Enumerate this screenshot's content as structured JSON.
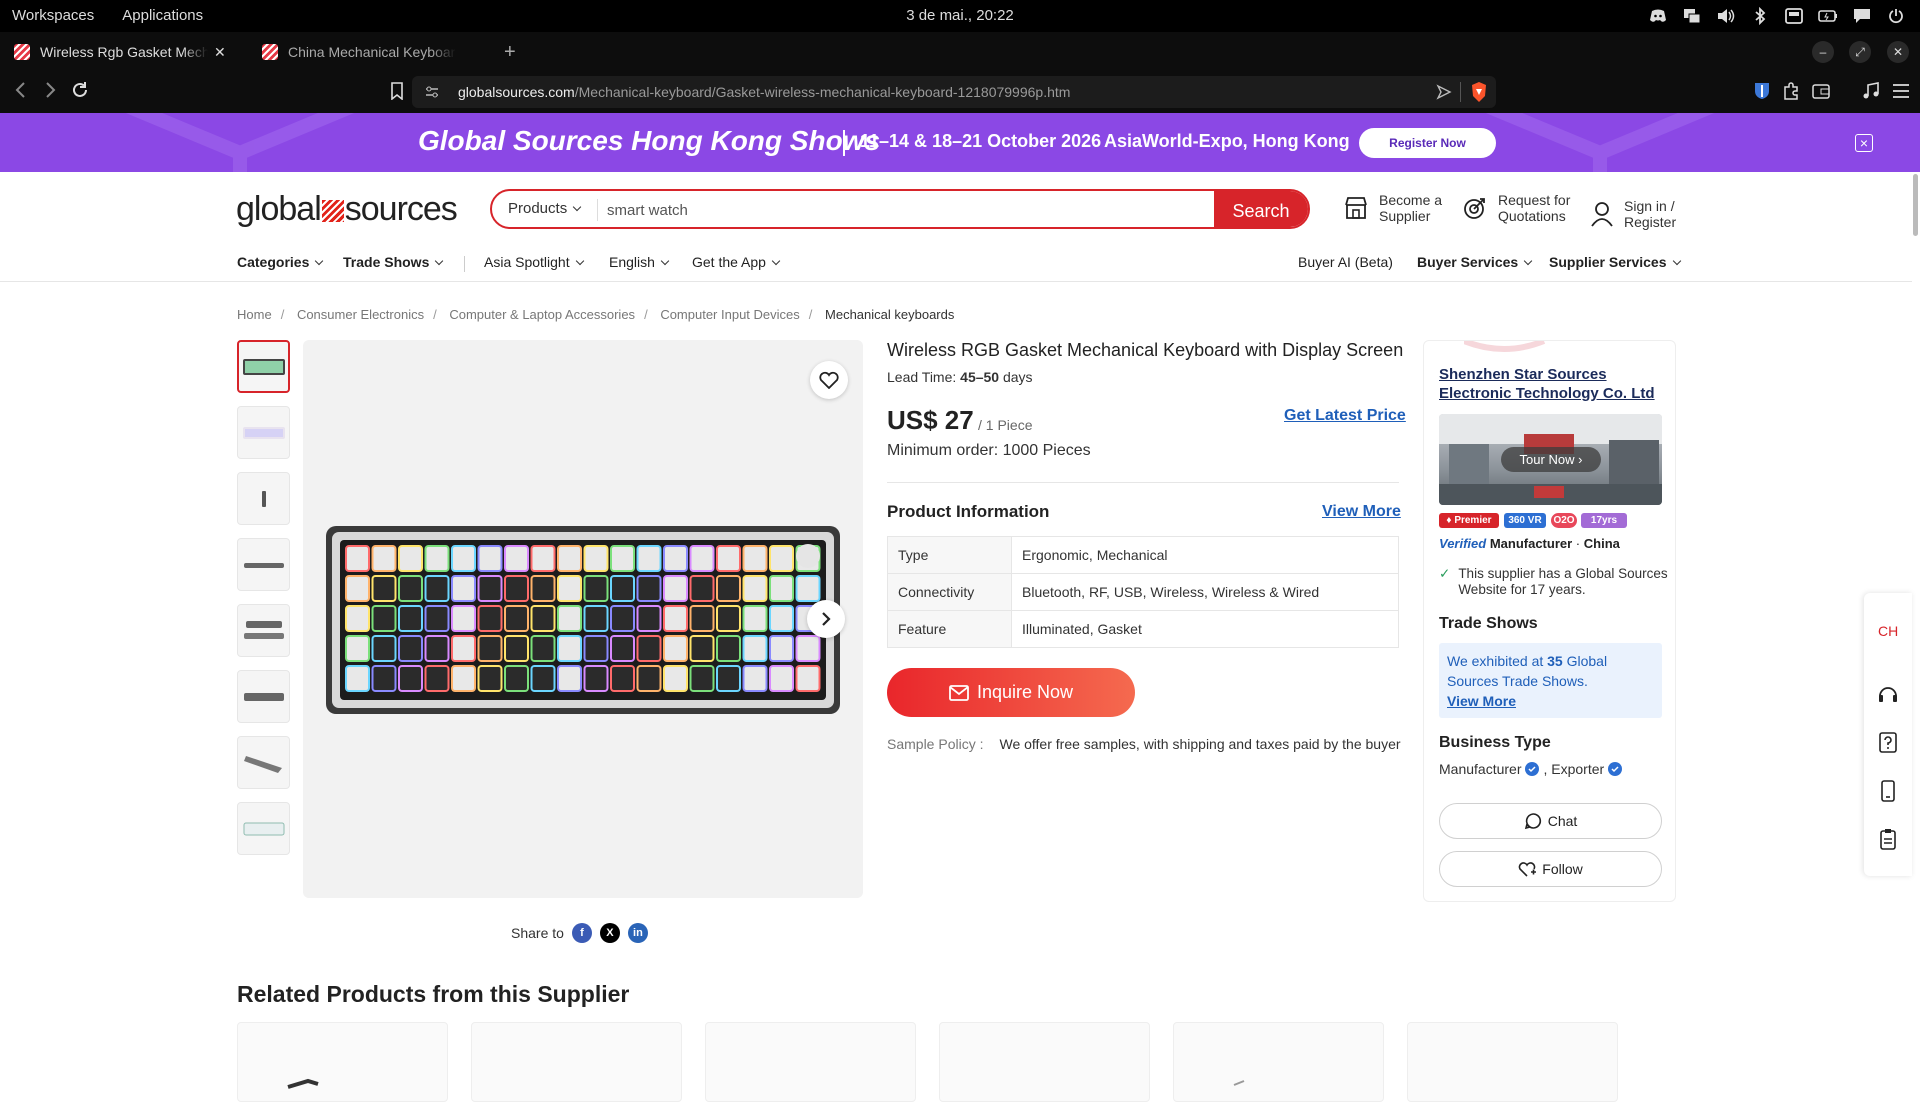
{
  "os": {
    "left_items": [
      "Workspaces",
      "Applications"
    ],
    "clock": "3 de mai., 20:22",
    "tray_icons": [
      "discord-icon",
      "network-icon",
      "volume-icon",
      "bluetooth-icon",
      "screen-icon",
      "battery-icon",
      "chat-icon",
      "power-icon"
    ]
  },
  "browser": {
    "tabs": [
      {
        "title": "Wireless Rgb Gasket Mechanic",
        "active": true
      },
      {
        "title": "China Mechanical Keyboard Offer",
        "active": false
      }
    ],
    "new_tab": "+",
    "url_domain": "globalsources.com",
    "url_path": "/Mechanical-keyboard/Gasket-wireless-mechanical-keyboard-1218079996p.htm"
  },
  "banner": {
    "title": "Global Sources Hong Kong Shows",
    "dates": "11–14 & 18–21 October 2026",
    "venue": "AsiaWorld-Expo, Hong Kong",
    "register": "Register Now",
    "bg": "#8b48e5"
  },
  "header": {
    "logo_left": "global",
    "logo_right": "sources",
    "search_category": "Products",
    "search_value": "smart watch",
    "search_button": "Search",
    "become_supplier": [
      "Become a",
      "Supplier"
    ],
    "rfq": [
      "Request for",
      "Quotations"
    ],
    "sign_in": "Sign in /",
    "register": "Register"
  },
  "nav": {
    "left": [
      "Categories",
      "Trade Shows",
      "Asia Spotlight",
      "English",
      "Get the App"
    ],
    "right": [
      "Buyer AI (Beta)",
      "Buyer Services",
      "Supplier Services"
    ]
  },
  "breadcrumb": [
    "Home",
    "Consumer Electronics",
    "Computer & Laptop Accessories",
    "Computer Input Devices",
    "Mechanical keyboards"
  ],
  "product": {
    "title": "Wireless RGB Gasket Mechanical Keyboard with Display Screen",
    "lead_label": "Lead Time:",
    "lead_value": "45–50",
    "lead_unit": "days",
    "price": "US$ 27",
    "unit": "/ 1 Piece",
    "get_latest_price": "Get Latest Price",
    "min_order": "Minimum order: 1000 Pieces",
    "info_title": "Product Information",
    "view_more": "View More",
    "specs": [
      {
        "key": "Type",
        "value": "Ergonomic, Mechanical"
      },
      {
        "key": "Connectivity",
        "value": "Bluetooth, RF, USB, Wireless, Wireless & Wired"
      },
      {
        "key": "Feature",
        "value": "Illuminated, Gasket"
      }
    ],
    "inquire": "Inquire Now",
    "sample_label": "Sample Policy :",
    "sample_value": "We offer free samples, with shipping and taxes paid by the buyer",
    "accent": "#d7242a"
  },
  "supplier": {
    "name": "Shenzhen Star Sources Electronic Technology Co. Ltd",
    "tour": "Tour Now",
    "badges": [
      "Premier",
      "360 VR",
      "O2O",
      "17yrs"
    ],
    "verified": "Verified",
    "manufacturer": "Manufacturer",
    "country": "China",
    "website_note": "This supplier has a Global Sources Website for 17 years.",
    "trade_shows_title": "Trade Shows",
    "trade_shows_pre": "We exhibited at",
    "trade_shows_count": "35",
    "trade_shows_post": "Global Sources Trade Shows.",
    "trade_shows_link": "View More",
    "business_type_title": "Business Type",
    "business_types": [
      "Manufacturer",
      ", Exporter"
    ],
    "chat": "Chat",
    "follow": "Follow"
  },
  "floatbar": {
    "lang": "CH"
  },
  "share": {
    "label": "Share to"
  },
  "related": {
    "title": "Related Products from this Supplier"
  }
}
